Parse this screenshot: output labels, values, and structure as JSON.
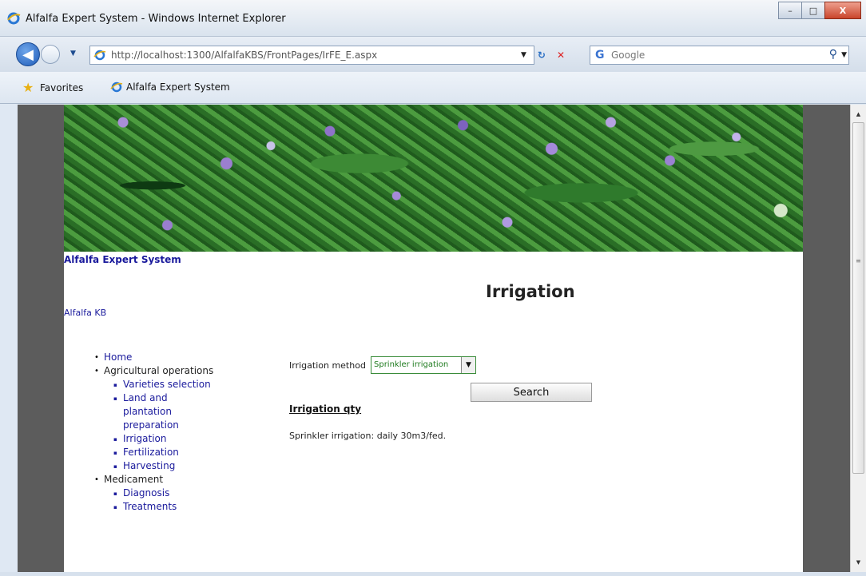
{
  "window": {
    "title": "Alfalfa Expert System - Windows Internet Explorer",
    "minimize": "–",
    "maximize": "□",
    "close": "X"
  },
  "navbar": {
    "back": "◀",
    "url": "http://localhost:1300/AlfalfaKBS/FrontPages/IrFE_E.aspx",
    "search_placeholder": "Google"
  },
  "favorites": {
    "label": "Favorites",
    "link": "Alfalfa Expert System"
  },
  "page": {
    "site_title": "Alfalfa Expert System",
    "heading": "Irrigation",
    "kb_link": "Alfalfa KB",
    "menu": {
      "home": "Home",
      "agri": "Agricultural operations",
      "varieties": "Varieties selection",
      "land": "Land and plantation preparation",
      "irrigation": "Irrigation",
      "fertilization": "Fertilization",
      "harvesting": "Harvesting",
      "medicament": "Medicament",
      "diagnosis": "Diagnosis",
      "treatments": "Treatments"
    },
    "form": {
      "method_label": "Irrigation method",
      "method_value": "Sprinkler irrigation",
      "search_button": "Search"
    },
    "result": {
      "heading": "Irrigation qty",
      "text": "Sprinkler irrigation: daily 30m3/fed."
    }
  }
}
